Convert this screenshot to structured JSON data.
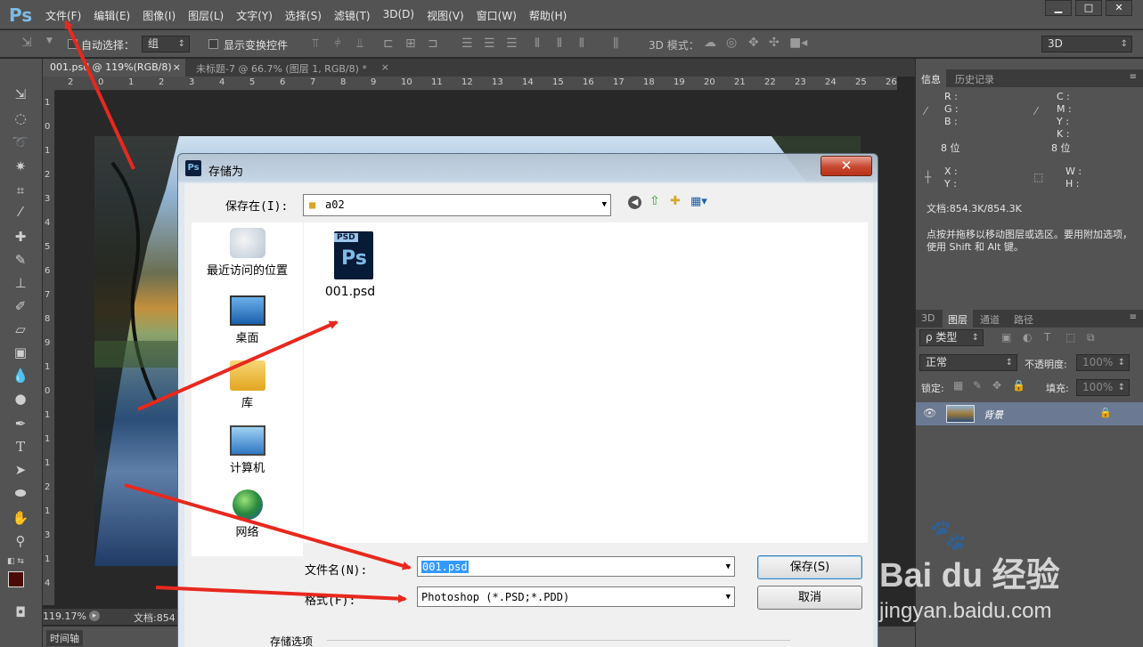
{
  "app": {
    "logo": "Ps"
  },
  "menubar": {
    "items": [
      "文件(F)",
      "编辑(E)",
      "图像(I)",
      "图层(L)",
      "文字(Y)",
      "选择(S)",
      "滤镜(T)",
      "3D(D)",
      "视图(V)",
      "窗口(W)",
      "帮助(H)"
    ]
  },
  "window_controls": {
    "minimize": "▁",
    "maximize": "□",
    "close": "✕"
  },
  "options_bar": {
    "auto_select_label": "自动选择：",
    "auto_select_value": "组",
    "show_transform_label": "显示变换控件",
    "mode_3d_label": "3D 模式：",
    "workspace_value": "3D"
  },
  "doc_tabs": [
    {
      "label": "001.psd @ 119%(RGB/8)",
      "close": "×"
    },
    {
      "label": "未标题-7 @ 66.7% (图层 1, RGB/8) *",
      "close": "×"
    }
  ],
  "ruler": {
    "h_ticks": [
      "2",
      "0",
      "1",
      "2",
      "3",
      "4",
      "5",
      "6",
      "7",
      "8",
      "9",
      "10",
      "11",
      "12",
      "13",
      "14",
      "15",
      "16",
      "17",
      "18",
      "19",
      "20",
      "21",
      "22",
      "23",
      "24",
      "25",
      "26"
    ],
    "v_ticks": [
      "1",
      "0",
      "1",
      "2",
      "3",
      "4",
      "5",
      "6",
      "7",
      "8",
      "9",
      "1",
      "0",
      "1",
      "1",
      "1",
      "2",
      "1",
      "3",
      "1",
      "4"
    ]
  },
  "status": {
    "zoom": "119.17%",
    "doc": "文档:854"
  },
  "timeline": {
    "label": "时间轴"
  },
  "info_panel": {
    "tabs": [
      "信息",
      "历史记录"
    ],
    "rgb": [
      "R :",
      "G :",
      "B :"
    ],
    "cmyk": [
      "C :",
      "M :",
      "Y :",
      "K :"
    ],
    "bit_left": "8 位",
    "bit_right": "8 位",
    "xy": [
      "X :",
      "Y :"
    ],
    "wh": [
      "W :",
      "H :"
    ],
    "doc_size": "文档:854.3K/854.3K",
    "hint": "点按并拖移以移动图层或选区。要用附加选项，使用 Shift 和 Alt 键。"
  },
  "layers_panel": {
    "tabs": [
      "3D",
      "图层",
      "通道",
      "路径"
    ],
    "filter_label": "ρ 类型",
    "blend_mode": "正常",
    "opacity_label": "不透明度:",
    "opacity_value": "100%",
    "lock_label": "锁定:",
    "fill_label": "填充:",
    "fill_value": "100%",
    "layer_name": "背景"
  },
  "save_dialog": {
    "title": "存储为",
    "title_icon": "Ps",
    "save_in_label": "保存在(I):",
    "save_in_value": "a02",
    "places": [
      "最近访问的位置",
      "桌面",
      "库",
      "计算机",
      "网络"
    ],
    "file_name_item": "001.psd",
    "file_icon_text": "PSD",
    "file_icon_ps": "Ps",
    "filename_label": "文件名(N):",
    "filename_value": "001.psd",
    "format_label": "格式(F):",
    "format_value": "Photoshop (*.PSD;*.PDD)",
    "save_button": "保存(S)",
    "cancel_button": "取消",
    "storage_options": "存储选项"
  },
  "watermark": {
    "brand": "Bai du 经验",
    "url": "jingyan.baidu.com"
  },
  "colors": {
    "ui_dark": "#535353",
    "accent": "#7fbbe6",
    "arrow": "#e8281e",
    "dialog_bg": "#f0f0f0"
  }
}
